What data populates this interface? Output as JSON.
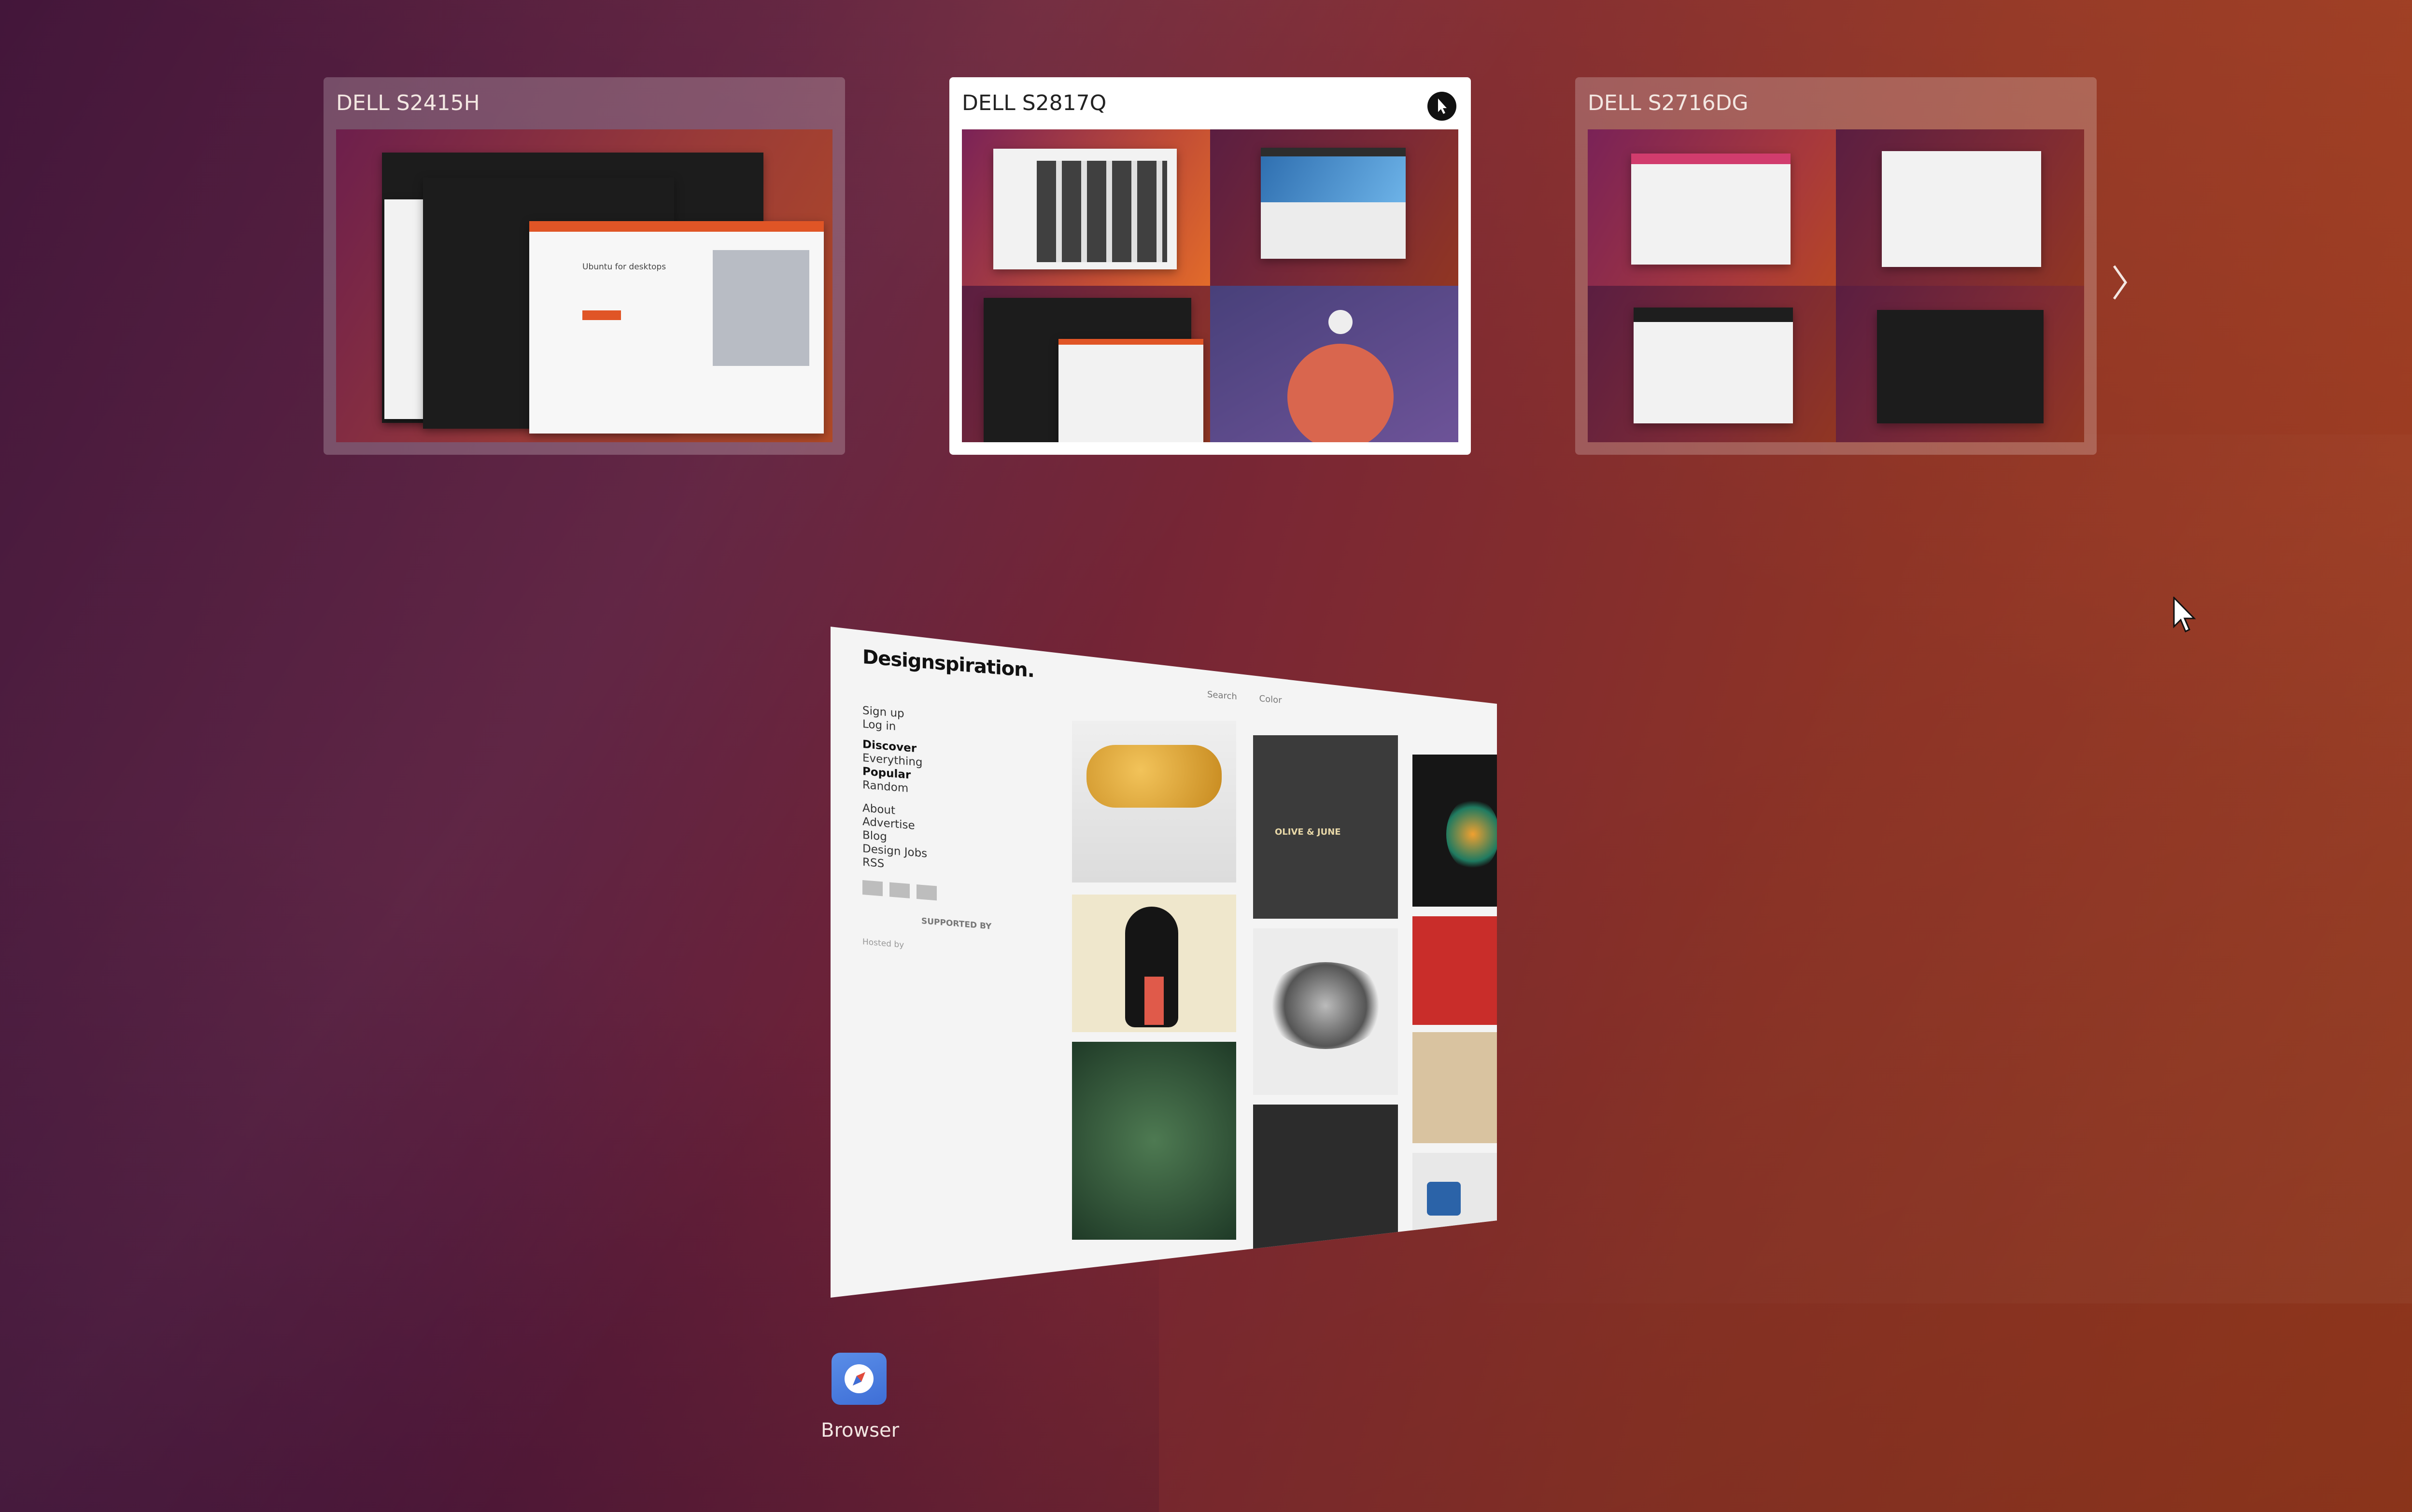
{
  "monitors": [
    {
      "name": "DELL S2415H",
      "active": false
    },
    {
      "name": "DELL S2817Q",
      "active": true
    },
    {
      "name": "DELL S2716DG",
      "active": false
    }
  ],
  "active_window": {
    "brand": "Designspiration.",
    "top_links": [
      "Search",
      "Color"
    ],
    "nav_account": [
      "Sign up",
      "Log in"
    ],
    "nav_discover_heading": "Discover",
    "nav_discover": [
      "Everything",
      "Popular",
      "Random"
    ],
    "nav_info": [
      "About",
      "Advertise",
      "Blog",
      "Design Jobs",
      "RSS"
    ],
    "supported_by": "SUPPORTED BY",
    "hosted_by": "Hosted by",
    "tile_texts": [
      "OLIVE & JUNE"
    ]
  },
  "ubuntu_page_snippet": "Ubuntu for desktops",
  "app": {
    "label": "Browser",
    "icon": "compass-icon"
  },
  "icons": {
    "next": "chevron-right-icon",
    "pin": "pointer-icon",
    "cursor": "mouse-pointer-icon"
  }
}
